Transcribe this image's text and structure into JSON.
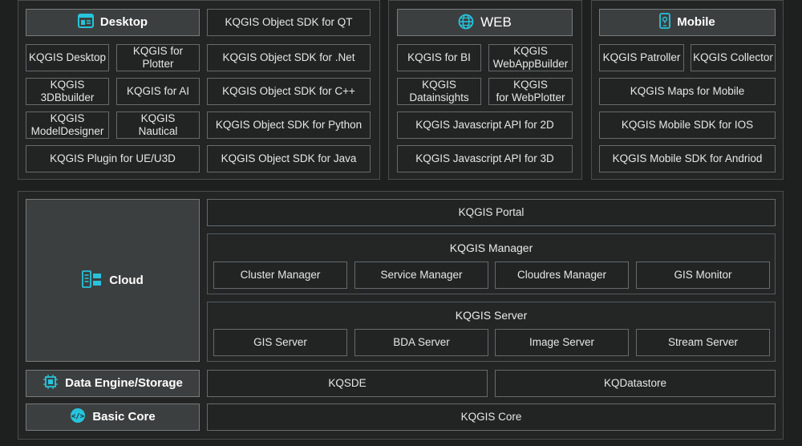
{
  "desktop": {
    "title": "Desktop",
    "items": [
      "KQGIS Desktop",
      "KQGIS for\nPlotter",
      "KQGIS\n3DBbuilder",
      "KQGIS for AI",
      "KQGIS\nModelDesigner",
      "KQGIS\nNautical",
      "KQGIS  Plugin for UE/U3D"
    ],
    "sdks": [
      "KQGIS Object SDK for QT",
      "KQGIS Object SDK for .Net",
      "KQGIS Object SDK for C++",
      "KQGIS Object SDK for Python",
      "KQGIS Object SDK for Java"
    ]
  },
  "web": {
    "title": "WEB",
    "items": [
      "KQGIS for BI",
      "KQGIS\nWebAppBuilder",
      "KQGIS\nDatainsights",
      "KQGIS\nfor WebPlotter",
      "KQGIS Javascript API for 2D",
      "KQGIS Javascript API for 3D"
    ]
  },
  "mobile": {
    "title": "Mobile",
    "items": [
      "KQGIS Patroller",
      "KQGIS Collector",
      "KQGIS Maps for Mobile",
      "KQGIS Mobile SDK for IOS",
      "KQGIS Mobile SDK for Andriod"
    ]
  },
  "cloud": {
    "title": "Cloud",
    "portal": "KQGIS Portal",
    "manager": {
      "title": "KQGIS Manager",
      "items": [
        "Cluster Manager",
        "Service Manager",
        "Cloudres Manager",
        "GIS Monitor"
      ]
    },
    "server": {
      "title": "KQGIS Server",
      "items": [
        "GIS Server",
        "BDA Server",
        "Image Server",
        "Stream Server"
      ]
    }
  },
  "data_engine": {
    "title": "Data Engine/Storage",
    "items": [
      "KQSDE",
      "KQDatastore"
    ]
  },
  "basic_core": {
    "title": "Basic Core",
    "item": "KQGIS Core"
  },
  "colors": {
    "accent": "#27c3dc",
    "border": "#666a6a",
    "header_bg": "#3b3f3f"
  },
  "icons": {
    "desktop": "window-icon",
    "web": "globe-icon",
    "mobile": "phone-icon",
    "cloud": "server-icon",
    "data": "chip-icon",
    "core": "hand-code-icon"
  }
}
